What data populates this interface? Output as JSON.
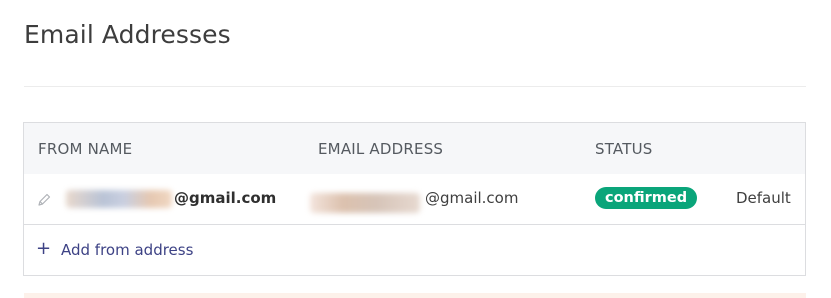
{
  "page_title": "Email Addresses",
  "table": {
    "headers": {
      "from_name": "FROM NAME",
      "email_address": "EMAIL ADDRESS",
      "status": "STATUS"
    },
    "rows": [
      {
        "from_name_domain": "@gmail.com",
        "email_domain": "@gmail.com",
        "status": "confirmed",
        "default_label": "Default"
      }
    ],
    "add_label": "Add from address",
    "add_icon": "+"
  },
  "colors": {
    "status_confirmed": "#0aa57a",
    "link": "#3d4285",
    "header_bg": "#f6f7f9"
  },
  "icons": {
    "edit": "pencil-icon",
    "add": "plus-icon"
  }
}
